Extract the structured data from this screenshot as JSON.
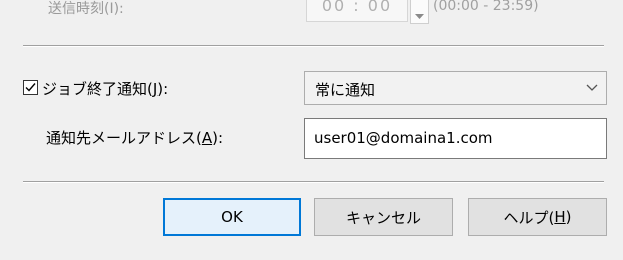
{
  "top_row": {
    "label": "送信時刻(I):",
    "time_value": "00 : 00",
    "time_range": "(00:00 - 23:59)"
  },
  "job_end_notify": {
    "checked": true,
    "label_prefix": "ジョブ終了通知(",
    "accesskey": "J",
    "label_suffix": "):",
    "selected_option": "常に通知"
  },
  "notify_address": {
    "label_prefix": "通知先メールアドレス(",
    "accesskey": "A",
    "label_suffix": "):",
    "value": "user01@domaina1.com"
  },
  "buttons": {
    "ok_label": "OK",
    "cancel_label": "キャンセル",
    "help_prefix": "ヘルプ(",
    "help_accesskey": "H",
    "help_suffix": ")"
  },
  "icons": {
    "checkbox": "check-icon",
    "dropdown": "chevron-down-icon",
    "spinner": "spin-down-icon"
  },
  "colors": {
    "background": "#f0f0f0",
    "default_button_border": "#0078d7",
    "default_button_fill": "#e5f1fb"
  }
}
